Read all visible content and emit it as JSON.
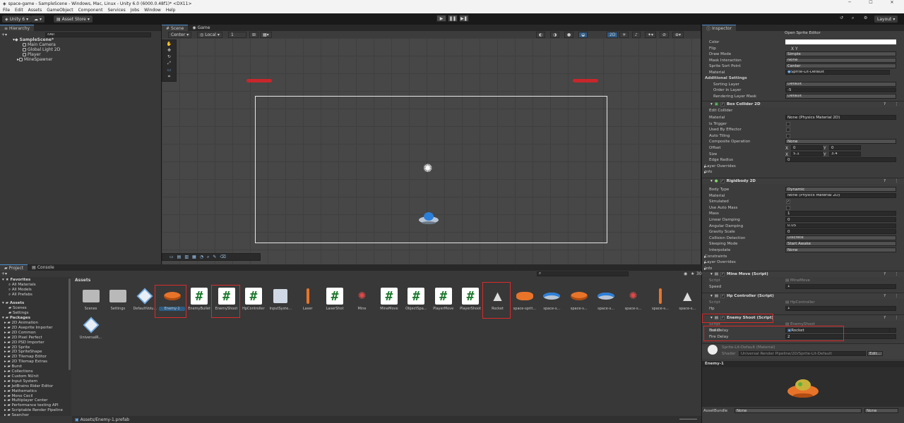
{
  "window": {
    "title": "space-game - SampleScene - Windows, Mac, Linux - Unity 6.0 (6000.0.48f1)* <DX11>"
  },
  "menu": [
    "File",
    "Edit",
    "Assets",
    "GameObject",
    "Component",
    "Services",
    "Jobs",
    "Window",
    "Help"
  ],
  "toolbar": {
    "unity_label": "Unity 6",
    "asset_store": "Asset Store",
    "layout": "Layout"
  },
  "hierarchy": {
    "tab": "Hierarchy",
    "search_placeholder": "All",
    "scene": "SampleScene*",
    "items": [
      "Main Camera",
      "Global Light 2D",
      "Player",
      "MineSpawner"
    ]
  },
  "scene": {
    "tabs": [
      "Scene",
      "Game"
    ],
    "pivot": "Center",
    "space": "Local",
    "grid_value": "1"
  },
  "project": {
    "tabs": [
      "Project",
      "Console"
    ],
    "breadcrumb": "Assets",
    "zoom_value": "30",
    "favorites": {
      "label": "Favorites",
      "items": [
        "All Materials",
        "All Models",
        "All Prefabs"
      ]
    },
    "assets": {
      "label": "Assets",
      "items": [
        "Scenes",
        "Settings"
      ]
    },
    "packages": {
      "label": "Packages",
      "items": [
        "2D Animation",
        "2D Aseprite Importer",
        "2D Common",
        "2D Pixel Perfect",
        "2D PSD Importer",
        "2D Sprite",
        "2D SpriteShape",
        "2D Tilemap Editor",
        "2D Tilemap Extras",
        "Burst",
        "Collections",
        "Custom NUnit",
        "Input System",
        "JetBrains Rider Editor",
        "Mathematics",
        "Mono Cecil",
        "Multiplayer Center",
        "Performance testing API",
        "Scriptable Render Pipeline",
        "Searcher"
      ]
    },
    "grid": [
      "Scenes",
      "Settings",
      "DefaultVolu...",
      "Enemy-1",
      "EnemyBullet",
      "EnemyShoot",
      "HpController",
      "InputSyste...",
      "Laser",
      "LaserShot",
      "Mine",
      "MineMove",
      "ObjectSpa...",
      "PlayerMove",
      "PlayerShoot",
      "Rocket",
      "space-sprit...",
      "space-s...",
      "space-s...",
      "space-s...",
      "space-s...",
      "space-s...",
      "space-s...",
      "UniversalR..."
    ],
    "status_path": "Assets/Enemy-1.prefab"
  },
  "inspector": {
    "tab": "Inspector",
    "open_editor": "Open Sprite Editor",
    "sprite": [
      [
        "Color",
        ""
      ],
      [
        "Flip",
        "X     Y"
      ],
      [
        "Draw Mode",
        "Simple"
      ],
      [
        "Mask Interaction",
        "None"
      ],
      [
        "Sprite Sort Point",
        "Center"
      ],
      [
        "Material",
        "Sprite-Lit-Default"
      ],
      [
        "Additional Settings",
        ""
      ],
      [
        "Sorting Layer",
        "Default"
      ],
      [
        "Order in Layer",
        "-5"
      ],
      [
        "Rendering Layer Mask",
        "Default"
      ]
    ],
    "box": {
      "title": "Box Collider 2D",
      "edit": "Edit Collider",
      "rows": [
        [
          "Material",
          "None (Physics Material 2D)"
        ],
        [
          "Is Trigger",
          ""
        ],
        [
          "Used By Effector",
          ""
        ],
        [
          "Auto Tiling",
          ""
        ],
        [
          "Composite Operation",
          "None"
        ],
        [
          "Offset",
          ""
        ],
        [
          "Size",
          ""
        ],
        [
          "Edge Radius",
          "0"
        ],
        [
          "Layer Overrides",
          ""
        ],
        [
          "Info",
          ""
        ]
      ],
      "offset": {
        "x": "0",
        "y": "0"
      },
      "size": {
        "x": "5.1",
        "y": "3.4"
      }
    },
    "rb": {
      "title": "Rigidbody 2D",
      "rows": [
        [
          "Body Type",
          "Dynamic"
        ],
        [
          "Material",
          "None (Physics Material 2D)"
        ],
        [
          "Simulated",
          "✓"
        ],
        [
          "Use Auto Mass",
          ""
        ],
        [
          "Mass",
          "1"
        ],
        [
          "Linear Damping",
          "0"
        ],
        [
          "Angular Damping",
          "0.05"
        ],
        [
          "Gravity Scale",
          "0"
        ],
        [
          "Collision Detection",
          "Discrete"
        ],
        [
          "Sleeping Mode",
          "Start Awake"
        ],
        [
          "Interpolate",
          "None"
        ],
        [
          "Constraints",
          ""
        ],
        [
          "Layer Overrides",
          ""
        ],
        [
          "Info",
          ""
        ]
      ]
    },
    "mine": {
      "title": "Mine Move (Script)",
      "script": "MineMove",
      "speed": "1"
    },
    "hp": {
      "title": "Hp Controller (Script)",
      "script": "HpController",
      "hp": "1"
    },
    "shoot": {
      "title": "Enemy Shoot (Script)",
      "script": "EnemyShoot",
      "bullet": "Rocket",
      "fire": "2"
    },
    "material": {
      "name": "Sprite-Lit-Default (Material)",
      "shader_label": "Shader",
      "shader": "Universal Render Pipeline/2D/Sprite-Lit-Default",
      "edit": "Edit..."
    },
    "labels": {
      "script": "Script",
      "speed": "Speed",
      "hp": "Hp",
      "bullet": "Bullet",
      "fire": "Fire Delay",
      "x": "X",
      "y": "Y"
    },
    "preview": "Enemy-1",
    "assetbundle_label": "AssetBundle",
    "bundle1": "None",
    "bundle2": "None"
  },
  "colors": {
    "accent": "#4d8ecd",
    "highlight": "#d92b2b",
    "panel": "#383838"
  }
}
